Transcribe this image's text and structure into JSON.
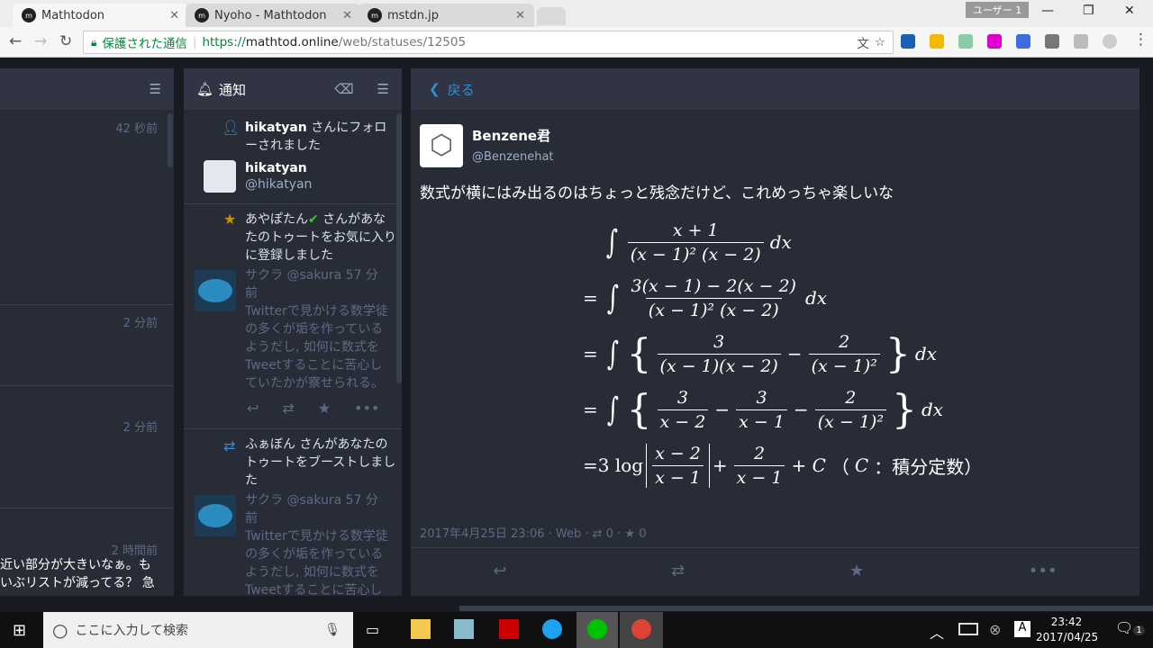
{
  "browser": {
    "tabs": [
      {
        "title": "Mathtodon",
        "active": true
      },
      {
        "title": "Nyoho - Mathtodon"
      },
      {
        "title": "mstdn.jp"
      }
    ],
    "user": "ユーザー 1",
    "secure_label": "保護された通信",
    "url_scheme": "https://",
    "url_host": "mathtod.online",
    "url_path": "/web/statuses/12505"
  },
  "left_column": {
    "times": [
      "42 秒前",
      "2 分前",
      "2 分前",
      "2 時間前"
    ],
    "snippet_lines": [
      "近い部分が大きいなぁ。も",
      "いぶリストが減ってる？ 急"
    ]
  },
  "notifications": {
    "title": "通知",
    "follow": {
      "user": "hikatyan",
      "text": " さんにフォローされました",
      "name": "hikatyan",
      "handle": "@hikatyan"
    },
    "fav": {
      "user": "あやぽたん",
      "text": " さんがあなたのトゥートをお気に入りに登録しました",
      "status": {
        "name": "サクラ",
        "handle": "@sakura",
        "time": "57 分前",
        "text": "Twitterで見かける数学徒の多くが垢を作っているようだし, 如何に数式をTweetすることに苦心していたかが察せられる。"
      }
    },
    "boost": {
      "user": "ふぁぼん",
      "text": " さんがあなたのトゥートをブーストしました",
      "status": {
        "name": "サクラ",
        "handle": "@sakura",
        "time": "57 分前",
        "text": "Twitterで見かける数学徒の多くが垢を作っているようだし, 如何に数式をTweetすることに苦心していたかが察せられる。"
      }
    }
  },
  "detail": {
    "back": "戻る",
    "name": "Benzene君",
    "handle": "@Benzenehat",
    "text": "数式が横にはみ出るのはちょっと残念だけど、これめっちゃ楽しいな",
    "math": [
      [
        [
          "int"
        ],
        [
          "f",
          "x + 1",
          "(x − 1)² (x − 2)"
        ],
        [
          "t",
          "dx"
        ]
      ],
      [
        [
          "t",
          "="
        ],
        [
          "int"
        ],
        [
          "f",
          "3(x − 1) − 2(x − 2)",
          "(x − 1)² (x − 2)"
        ],
        [
          "t",
          "dx"
        ]
      ],
      [
        [
          "t",
          "="
        ],
        [
          "int"
        ],
        [
          "lb"
        ],
        [
          "f",
          "3",
          "(x − 1)(x − 2)"
        ],
        [
          "t",
          "−"
        ],
        [
          "f",
          "2",
          "(x − 1)²"
        ],
        [
          "rb"
        ],
        [
          "t",
          "dx"
        ]
      ],
      [
        [
          "t",
          "="
        ],
        [
          "int"
        ],
        [
          "lb"
        ],
        [
          "f",
          "3",
          "x − 2"
        ],
        [
          "t",
          "−"
        ],
        [
          "f",
          "3",
          "x − 1"
        ],
        [
          "t",
          "−"
        ],
        [
          "f",
          "2",
          "(x − 1)²"
        ],
        [
          "rb"
        ],
        [
          "t",
          "dx"
        ]
      ],
      [
        [
          "u",
          "=3 log"
        ],
        [
          "abs",
          "x − 2",
          "x − 1"
        ],
        [
          "t",
          "+"
        ],
        [
          "f",
          "2",
          "x − 1"
        ],
        [
          "t",
          "+ C"
        ],
        [
          "u",
          "（"
        ],
        [
          "t",
          "C"
        ],
        [
          "u",
          "：積分定数）"
        ]
      ]
    ],
    "date": "2017年4月25日 23:06",
    "app": "Web",
    "boosts": "0",
    "favs": "0"
  },
  "taskbar": {
    "search_placeholder": "ここに入力して検索",
    "time": "23:42",
    "date": "2017/04/25",
    "notif_count": "1"
  }
}
